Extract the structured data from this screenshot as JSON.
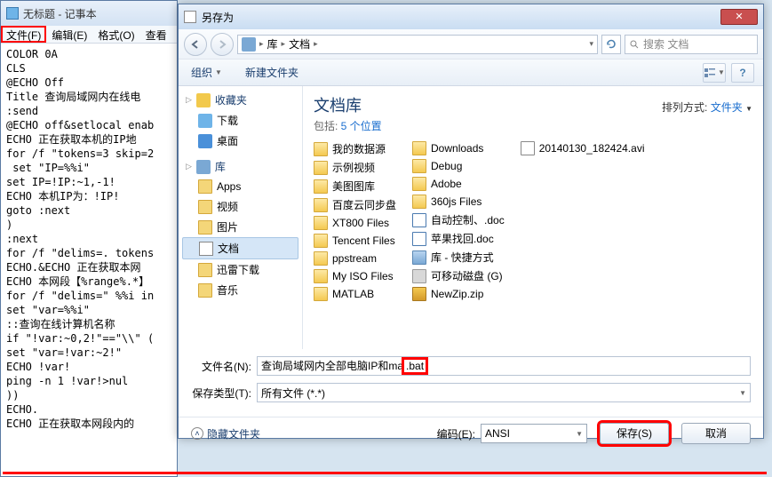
{
  "notepad": {
    "title": "无标题 - 记事本",
    "menu": {
      "file": "文件(F)",
      "edit": "编辑(E)",
      "format": "格式(O)",
      "view": "查看"
    },
    "body": "COLOR 0A\nCLS\n@ECHO Off\nTitle 查询局域网内在线电\n:send\n@ECHO off&setlocal enab\nECHO 正在获取本机的IP地\nfor /f \"tokens=3 skip=2\n set \"IP=%%i\"\nset IP=!IP:~1,-1!\nECHO 本机IP为：!IP!\ngoto :next\n)\n:next\nfor /f \"delims=. tokens\nECHO.&ECHO 正在获取本网\nECHO 本网段【%range%.*】\nfor /f \"delims=\" %%i in\nset \"var=%%i\"\n::查询在线计算机名称\nif \"!var:~0,2!\"==\"\\\\\" (\nset \"var=!var:~2!\"\nECHO !var!\nping -n 1 !var!>nul\n))\nECHO.\nECHO 正在获取本网段内的"
  },
  "dialog": {
    "title": "另存为",
    "crumbs": [
      "库",
      "文档"
    ],
    "search_placeholder": "搜索 文档",
    "toolbar": {
      "organize": "组织",
      "newfolder": "新建文件夹"
    },
    "tree": {
      "fav": {
        "label": "收藏夹",
        "items": [
          "下载",
          "桌面"
        ]
      },
      "lib": {
        "label": "库",
        "items": [
          "Apps",
          "视频",
          "图片",
          "文档",
          "迅雷下载",
          "音乐"
        ]
      }
    },
    "content": {
      "title": "文档库",
      "subtitle_prefix": "包括: ",
      "subtitle_link": "5 个位置",
      "sort_label": "排列方式: ",
      "sort_value": "文件夹",
      "col1": [
        "我的数据源",
        "示例视频",
        "美图图库",
        "百度云同步盘",
        "XT800 Files",
        "Tencent Files",
        "ppstream",
        "My ISO Files",
        "MATLAB"
      ],
      "col2": [
        {
          "n": "Downloads",
          "t": "folder"
        },
        {
          "n": "Debug",
          "t": "folder"
        },
        {
          "n": "Adobe",
          "t": "folder"
        },
        {
          "n": "360js Files",
          "t": "folder"
        },
        {
          "n": "自动控制、.doc",
          "t": "docx"
        },
        {
          "n": "苹果找回.doc",
          "t": "docx"
        },
        {
          "n": "库 - 快捷方式",
          "t": "lib"
        },
        {
          "n": "可移动磁盘 (G)",
          "t": "drive"
        },
        {
          "n": "NewZip.zip",
          "t": "zip"
        }
      ],
      "col3": [
        {
          "n": "20140130_182424.avi",
          "t": "avi"
        }
      ]
    },
    "form": {
      "filename_label": "文件名(N):",
      "filename_value": "查询局域网内全部电脑IP和ma",
      "filename_ext": ".bat",
      "filetype_label": "保存类型(T):",
      "filetype_value": "所有文件 (*.*)"
    },
    "bottom": {
      "hide": "隐藏文件夹",
      "encoding_label": "编码(E):",
      "encoding_value": "ANSI",
      "save": "保存(S)",
      "cancel": "取消"
    }
  }
}
